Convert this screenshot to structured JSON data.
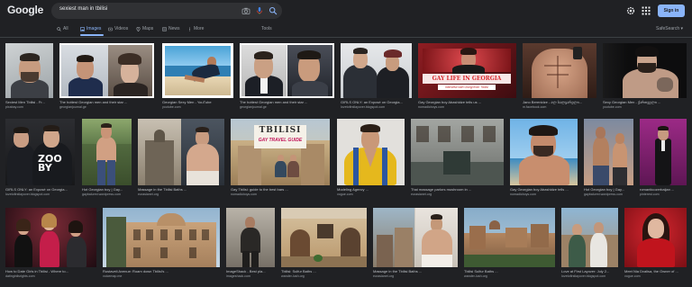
{
  "header": {
    "logo": "Google",
    "query": "sexiest man in tbilisi",
    "signin_label": "Sign in"
  },
  "tabs": [
    {
      "label": "All",
      "icon": "search-icon"
    },
    {
      "label": "Images",
      "icon": "image-icon",
      "active": true
    },
    {
      "label": "Videos",
      "icon": "video-icon"
    },
    {
      "label": "Maps",
      "icon": "map-pin-icon"
    },
    {
      "label": "News",
      "icon": "news-icon"
    },
    {
      "label": "More",
      "icon": "more-vert-icon"
    }
  ],
  "tools_label": "Tools",
  "safesearch_label": "SafeSearch ▾",
  "results": [
    {
      "caption": "Sexiest Men Tbilisi - Fr...",
      "source": "pixabay.com"
    },
    {
      "caption": "The hottest Georgian men and their star ...",
      "source": "georgianjournal.ge"
    },
    {
      "caption": "Georgian Sexy Men - YouTube",
      "source": "youtube.com"
    },
    {
      "caption": "The hottest Georgian men and their star ...",
      "source": "georgianjournal.ge"
    },
    {
      "caption": "GIRLS ONLY: an Exposé on Georgia...",
      "source": "lovetofirstlayover.blogspot.com"
    },
    {
      "caption": "Gay Georgian boy Abashidze tells us ...",
      "source": "nomadicboys.com"
    },
    {
      "caption": "Jano Berenidze - ალ ბალყარელი...",
      "source": "m.facebook.com"
    },
    {
      "caption": "Sexy Georgian Men - ქართველი ...",
      "source": "youtube.com"
    },
    {
      "caption": "GIRLS ONLY: an Exposé on Georgia...",
      "source": "lovetofirstlayover.blogspot.com"
    },
    {
      "caption": "Hot Georgian boy | Gay...",
      "source": "gaybalurmi.wordpress.com"
    },
    {
      "caption": "Massage in the Tbilisi Baths ...",
      "source": "eurasianet.org"
    },
    {
      "caption": "Gay Tbilisi: guide to the best bars ...",
      "source": "nomadicboys.com"
    },
    {
      "caption": "Modeling Agency ...",
      "source": "vogue.com"
    },
    {
      "caption": "Thai massage parlors mushroom in ...",
      "source": "eurasianet.org"
    },
    {
      "caption": "Gay Georgian boy Abashidze tells ...",
      "source": "nomadicboys.com"
    },
    {
      "caption": "Hot Georgian boy | Gay...",
      "source": "gaybalurmi.wordpress.com"
    },
    {
      "caption": "romanticozerbaijan ...",
      "source": "pinterest.com"
    },
    {
      "caption": "How to Date Girls in Tbilisi - Where to...",
      "source": "datinginlisrights.com"
    },
    {
      "caption": "Rustaveli Avenue: Roam down Tbilisi's ...",
      "source": "voicemap.me"
    },
    {
      "caption": "ImageShack - Best pla...",
      "source": "imageshack.com"
    },
    {
      "caption": "Tbilisi: Sulfur Baths ...",
      "source": "wander-lush.org"
    },
    {
      "caption": "Massage in the Tbilisi Baths ...",
      "source": "eurasianet.org"
    },
    {
      "caption": "Tbilisi Sulfur Baths ...",
      "source": "wander-lush.org"
    },
    {
      "caption": "Love at First Layover: July 2...",
      "source": "lovetofirstlayover.blogspot.com"
    },
    {
      "caption": "Meet Nia Dvalisa, the Owner of ...",
      "source": "vogue.com"
    }
  ],
  "overlays": {
    "gay_life_title": "GAY LIFE IN GEORGIA",
    "gay_life_sub": "interview with Giorgi from Tbilisi",
    "tbilisi_title": "TBILISI",
    "tbilisi_sub": "GAY TRAVEL GUIDE",
    "zoo_text": "ZOO\nBY"
  },
  "colors": {
    "background": "#202124",
    "accent": "#8ab4f8",
    "search_box": "#303134"
  }
}
